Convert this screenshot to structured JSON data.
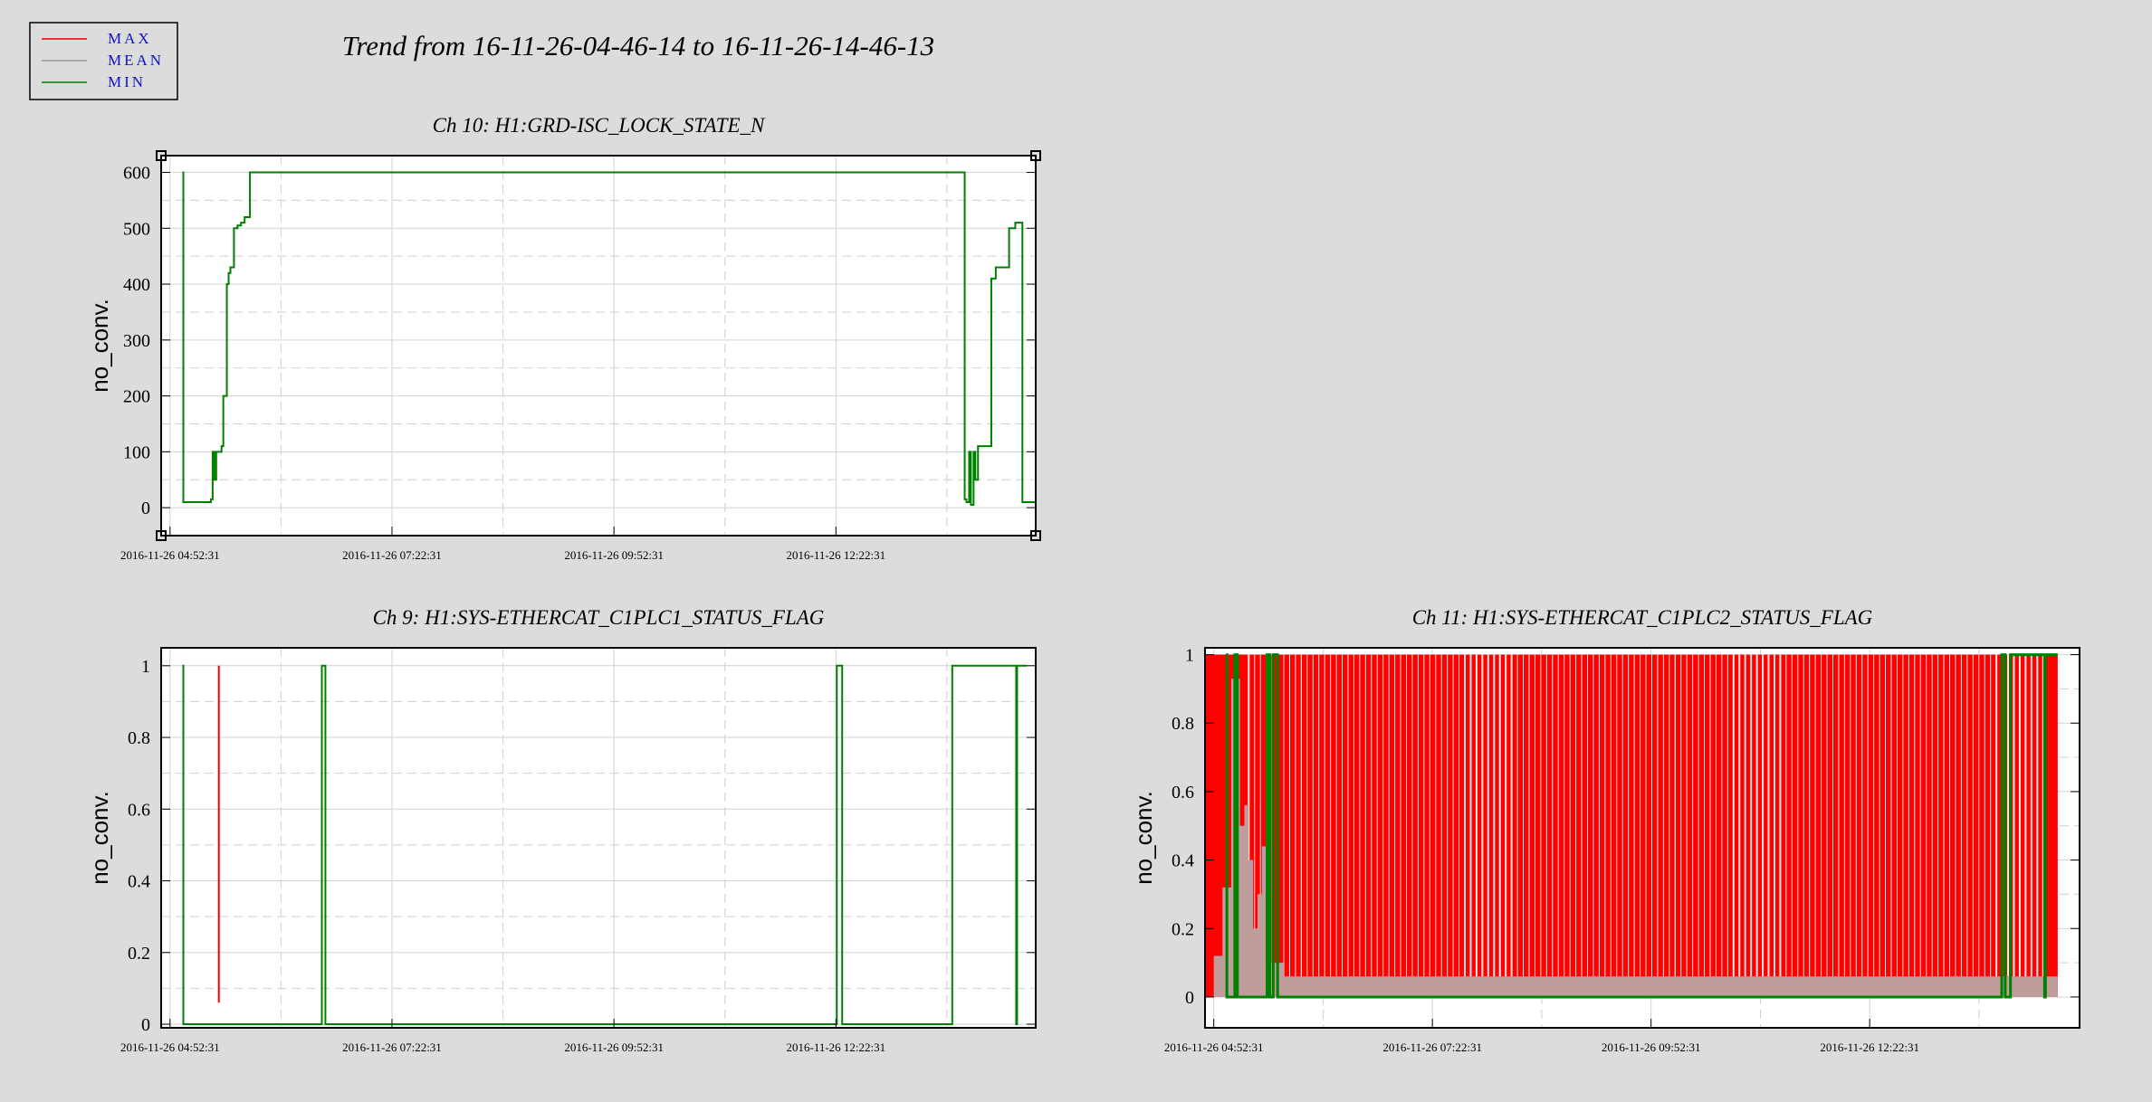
{
  "main_title": "Trend from 16-11-26-04-46-14 to 16-11-26-14-46-13",
  "legend": [
    {
      "label": "MAX",
      "color": "#e00000"
    },
    {
      "label": "MEAN",
      "color": "#999999"
    },
    {
      "label": "MIN",
      "color": "#008000"
    }
  ],
  "colors": {
    "background": "#dcdcdc",
    "plot_bg": "#ffffff",
    "max": "#ff0000",
    "mean": "#bf9d9d",
    "min": "#008000",
    "legend_text": "#1010d0"
  },
  "chart_data": [
    {
      "id": "ch10",
      "type": "line",
      "title": "Ch 10: H1:GRD-ISC_LOCK_STATE_N",
      "ylabel": "no_conv.",
      "xlabel": "",
      "ylim": [
        -50,
        630
      ],
      "yticks": [
        0,
        100,
        200,
        300,
        400,
        500,
        600
      ],
      "ytick_labels": [
        "0",
        "100",
        "200",
        "300",
        "400",
        "500",
        "600"
      ],
      "xlim": [
        -0.1,
        9.75
      ],
      "xticks": [
        0,
        2.5,
        5,
        7.5
      ],
      "xtick_labels": [
        "2016-11-26 04:52:31",
        "2016-11-26 07:22:31",
        "2016-11-26 09:52:31",
        "2016-11-26 12:22:31"
      ],
      "grid": true,
      "legend_position": "top-left",
      "series": [
        {
          "name": "MIN",
          "x": [
            0.14,
            0.15,
            0.46,
            0.48,
            0.5,
            0.52,
            0.58,
            0.6,
            0.64,
            0.66,
            0.68,
            0.7,
            0.72,
            0.74,
            0.76,
            0.8,
            0.84,
            0.9,
            0.95,
            1.0,
            8.8,
            8.95,
            8.97,
            9.0,
            9.02,
            9.05,
            9.07,
            9.1,
            9.15,
            9.25,
            9.3,
            9.35,
            9.45,
            9.52,
            9.6,
            9.75
          ],
          "y": [
            600,
            10,
            15,
            100,
            50,
            100,
            110,
            200,
            400,
            420,
            430,
            430,
            500,
            500,
            505,
            510,
            520,
            600,
            600,
            600,
            600,
            15,
            10,
            100,
            5,
            100,
            50,
            110,
            110,
            410,
            430,
            430,
            500,
            510,
            10,
            10
          ]
        }
      ]
    },
    {
      "id": "ch9",
      "type": "line",
      "title": "Ch 9: H1:SYS-ETHERCAT_C1PLC1_STATUS_FLAG",
      "ylabel": "no_conv.",
      "xlabel": "",
      "ylim": [
        -0.01,
        1.05
      ],
      "yticks": [
        0,
        0.2,
        0.4,
        0.6,
        0.8,
        1
      ],
      "ytick_labels": [
        "0",
        "0.2",
        "0.4",
        "0.6",
        "0.8",
        "1"
      ],
      "xlim": [
        -0.1,
        9.75
      ],
      "xticks": [
        0,
        2.5,
        5,
        7.5
      ],
      "xtick_labels": [
        "2016-11-26 04:52:31",
        "2016-11-26 07:22:31",
        "2016-11-26 09:52:31",
        "2016-11-26 12:22:31"
      ],
      "grid": true,
      "legend_position": "top-left",
      "series": [
        {
          "name": "MAX",
          "x": [
            0.55,
            0.55
          ],
          "y": [
            0.06,
            1
          ]
        },
        {
          "name": "MIN",
          "x": [
            0.14,
            0.15,
            1.7,
            1.71,
            1.74,
            1.75,
            7.5,
            7.51,
            7.56,
            7.57,
            8.8,
            8.81,
            9.53,
            9.54,
            9.65
          ],
          "y": [
            1,
            0,
            0,
            1,
            1,
            0,
            0,
            1,
            1,
            0,
            0,
            1,
            0,
            1,
            1
          ]
        }
      ]
    },
    {
      "id": "ch11",
      "type": "area",
      "title": "Ch 11: H1:SYS-ETHERCAT_C1PLC2_STATUS_FLAG",
      "ylabel": "no_conv.",
      "xlabel": "",
      "ylim": [
        -0.09,
        1.02
      ],
      "yticks": [
        0,
        0.2,
        0.4,
        0.6,
        0.8,
        1
      ],
      "ytick_labels": [
        "0",
        "0.2",
        "0.4",
        "0.6",
        "0.8",
        "1"
      ],
      "xlim": [
        -0.1,
        9.9
      ],
      "xticks": [
        0,
        2.5,
        5,
        7.5
      ],
      "xtick_labels": [
        "2016-11-26 04:52:31",
        "2016-11-26 07:22:31",
        "2016-11-26 09:52:31",
        "2016-11-26 12:22:31"
      ],
      "grid": true,
      "legend_position": "top-left",
      "series": [
        {
          "name": "MAX",
          "x": [
            -0.1,
            9.65
          ],
          "y": [
            1,
            1
          ]
        },
        {
          "name": "MEAN",
          "x": [
            0.0,
            0.1,
            0.2,
            0.3,
            0.35,
            0.4,
            0.45,
            0.5,
            0.55,
            0.6,
            0.8,
            9.65
          ],
          "y": [
            0.12,
            0.32,
            0.93,
            0.5,
            0.56,
            0.4,
            0.2,
            0.3,
            0.44,
            0.1,
            0.06,
            0.06
          ]
        },
        {
          "name": "MIN",
          "x": [
            0.14,
            0.15,
            0.23,
            0.24,
            0.26,
            0.27,
            0.6,
            0.61,
            0.63,
            0.64,
            0.67,
            0.68,
            0.72,
            0.73,
            9.0,
            9.01,
            9.04,
            9.05,
            9.1,
            9.11,
            9.5,
            9.51,
            9.65
          ],
          "y": [
            1,
            0,
            0,
            1,
            1,
            0,
            0,
            1,
            1,
            0,
            0,
            1,
            1,
            0,
            0,
            1,
            1,
            0,
            0,
            1,
            0,
            1,
            1
          ]
        }
      ]
    }
  ]
}
